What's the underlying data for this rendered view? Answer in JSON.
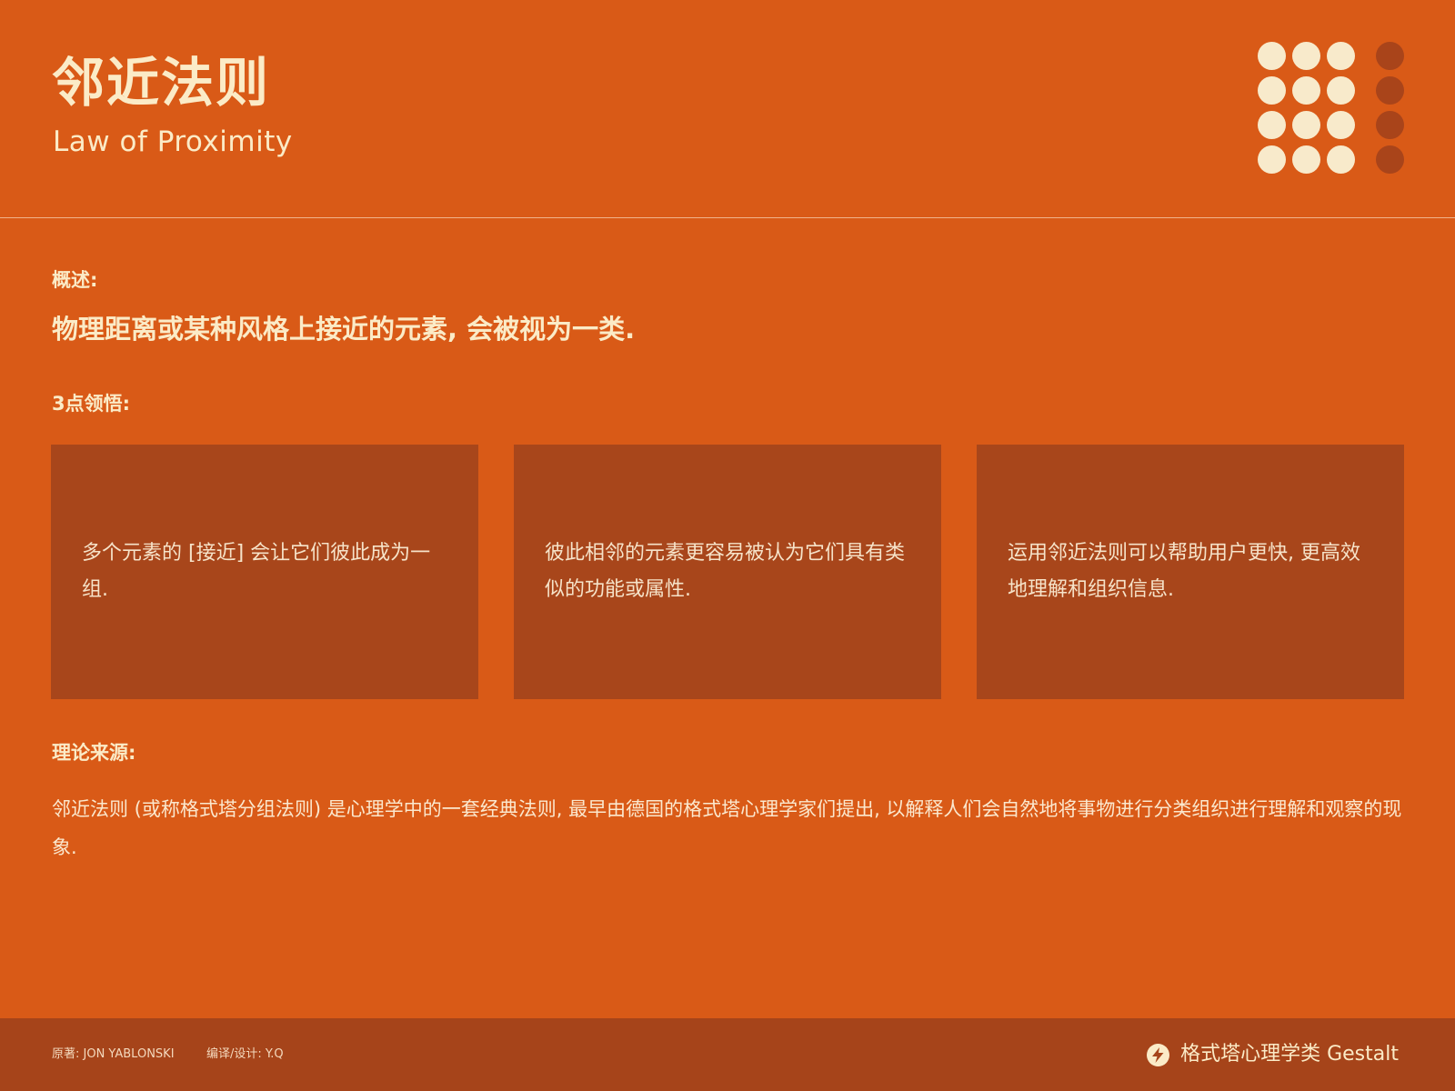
{
  "header": {
    "title": "邻近法则",
    "subtitle": "Law of Proximity"
  },
  "overview": {
    "label": "概述:",
    "text": "物理距离或某种风格上接近的元素, 会被视为一类."
  },
  "insights": {
    "label": "3点领悟:",
    "cards": [
      "多个元素的 [接近] 会让它们彼此成为一组.",
      "彼此相邻的元素更容易被认为它们具有类似的功能或属性.",
      "运用邻近法则可以帮助用户更快, 更高效地理解和组织信息."
    ]
  },
  "theory": {
    "label": "理论来源:",
    "text": "邻近法则 (或称格式塔分组法则) 是心理学中的一套经典法则, 最早由德国的格式塔心理学家们提出, 以解释人们会自然地将事物进行分类组织进行理解和观察的现象."
  },
  "footer": {
    "original": "原著: JON YABLONSKI",
    "design": "编译/设计: Y.Q",
    "brand": "格式塔心理学类 Gestalt"
  },
  "decoration": {
    "grid_rows": 4,
    "light_columns": 3,
    "dark_columns": 1,
    "icons": [
      "bolt-icon"
    ]
  },
  "colors": {
    "background": "#D95A17",
    "card": "#A8461B",
    "footer": "#A6441A",
    "text": "#FBEBC7",
    "dot_light": "#F8EACB",
    "dot_dark": "#A9441A"
  }
}
